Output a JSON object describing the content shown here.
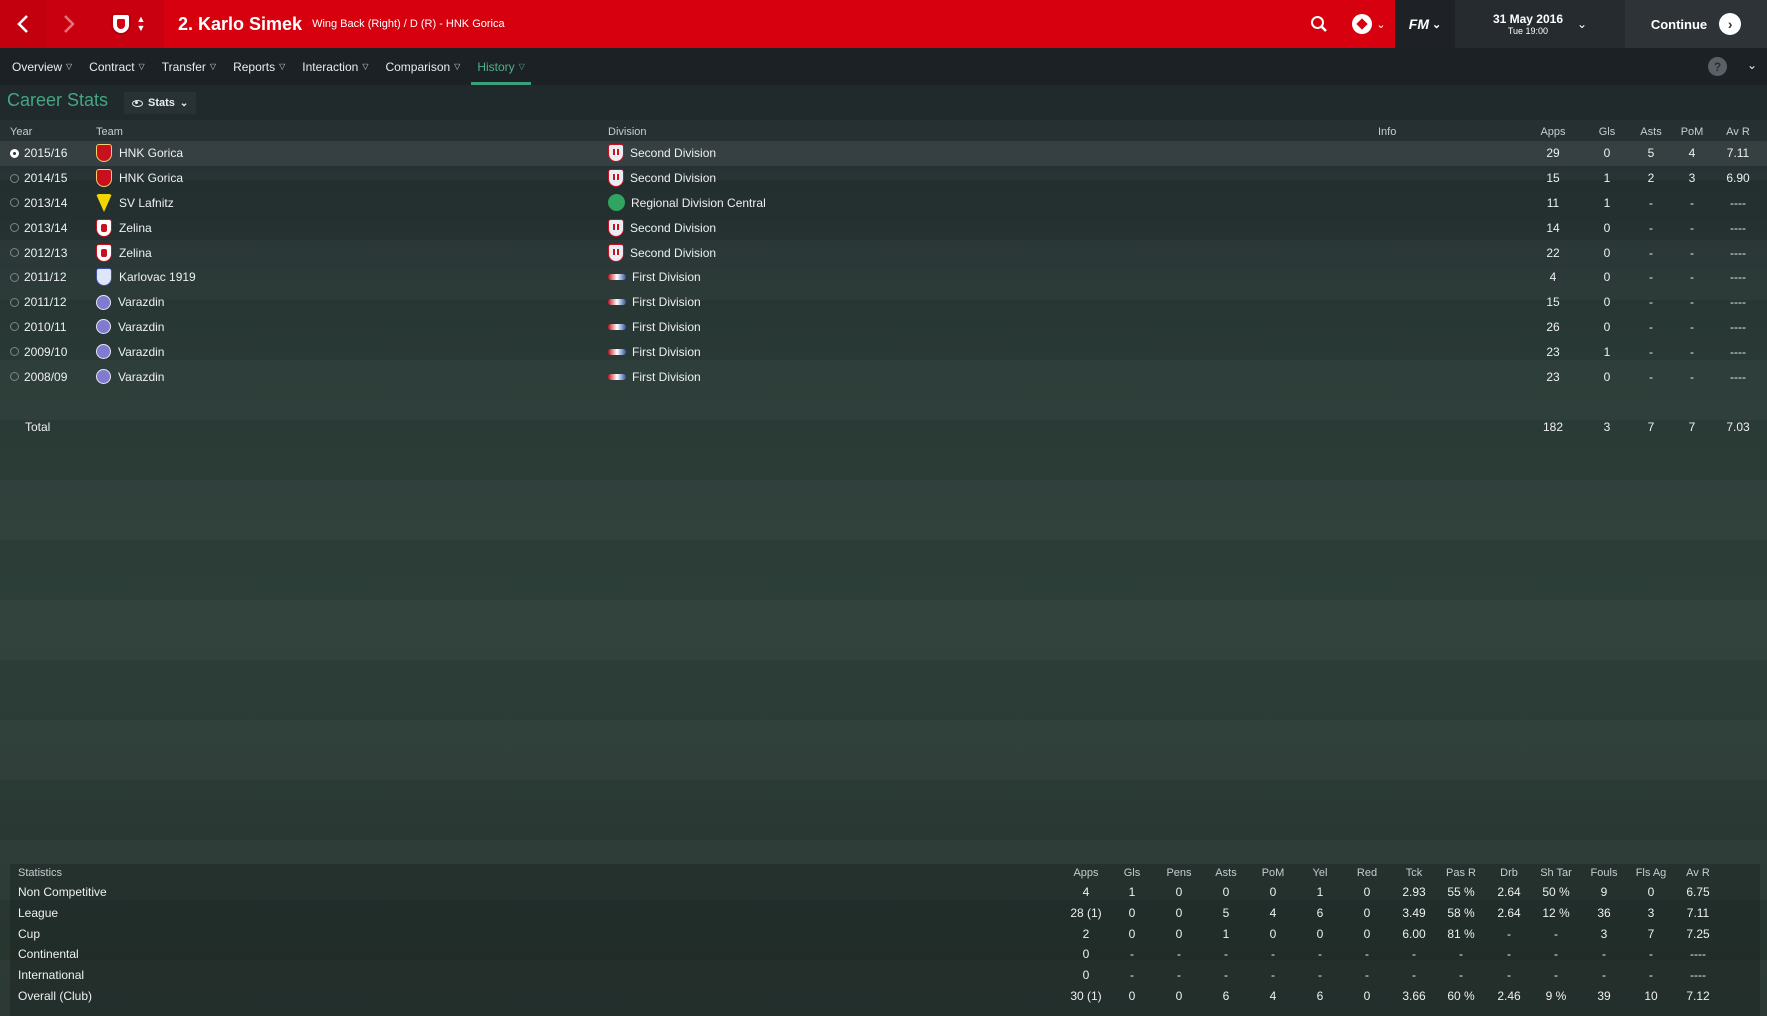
{
  "header": {
    "player_name": "2. Karlo Simek",
    "player_subtitle": "Wing Back (Right) / D (R) - HNK Gorica",
    "date": "31 May 2016",
    "day_time": "Tue 19:00",
    "continue_label": "Continue",
    "fm_label": "FM",
    "colors": {
      "bar": "#d7000f",
      "accent": "#45a683"
    }
  },
  "tabs": [
    {
      "label": "Overview"
    },
    {
      "label": "Contract"
    },
    {
      "label": "Transfer"
    },
    {
      "label": "Reports"
    },
    {
      "label": "Interaction"
    },
    {
      "label": "Comparison"
    },
    {
      "label": "History",
      "active": true
    }
  ],
  "section": {
    "title": "Career Stats",
    "view_dropdown": "Stats"
  },
  "career": {
    "columns": {
      "year": "Year",
      "team": "Team",
      "division": "Division",
      "info": "Info",
      "apps": "Apps",
      "gls": "Gls",
      "asts": "Asts",
      "pom": "PoM",
      "avr": "Av R"
    },
    "rows": [
      {
        "year": "2015/16",
        "team": "HNK Gorica",
        "team_icon": "hnk-gorica-crest-icon",
        "division": "Second Division",
        "div_icon": "croatia-league-icon",
        "apps": "29",
        "gls": "0",
        "asts": "5",
        "pom": "4",
        "avr": "7.11"
      },
      {
        "year": "2014/15",
        "team": "HNK Gorica",
        "team_icon": "hnk-gorica-crest-icon",
        "division": "Second Division",
        "div_icon": "croatia-league-icon",
        "apps": "15",
        "gls": "1",
        "asts": "2",
        "pom": "3",
        "avr": "6.90"
      },
      {
        "year": "2013/14",
        "team": "SV Lafnitz",
        "team_icon": "sv-lafnitz-crest-icon",
        "division": "Regional Division Central",
        "div_icon": "austria-league-icon",
        "apps": "11",
        "gls": "1",
        "asts": "-",
        "pom": "-",
        "avr": "----"
      },
      {
        "year": "2013/14",
        "team": "Zelina",
        "team_icon": "zelina-crest-icon",
        "division": "Second Division",
        "div_icon": "croatia-league-icon",
        "apps": "14",
        "gls": "0",
        "asts": "-",
        "pom": "-",
        "avr": "----"
      },
      {
        "year": "2012/13",
        "team": "Zelina",
        "team_icon": "zelina-crest-icon",
        "division": "Second Division",
        "div_icon": "croatia-league-icon",
        "apps": "22",
        "gls": "0",
        "asts": "-",
        "pom": "-",
        "avr": "----"
      },
      {
        "year": "2011/12",
        "team": "Karlovac 1919",
        "team_icon": "karlovac-crest-icon",
        "division": "First Division",
        "div_icon": "first-division-icon",
        "apps": "4",
        "gls": "0",
        "asts": "-",
        "pom": "-",
        "avr": "----"
      },
      {
        "year": "2011/12",
        "team": "Varazdin",
        "team_icon": "varazdin-crest-icon",
        "division": "First Division",
        "div_icon": "first-division-icon",
        "apps": "15",
        "gls": "0",
        "asts": "-",
        "pom": "-",
        "avr": "----"
      },
      {
        "year": "2010/11",
        "team": "Varazdin",
        "team_icon": "varazdin-crest-icon",
        "division": "First Division",
        "div_icon": "first-division-icon",
        "apps": "26",
        "gls": "0",
        "asts": "-",
        "pom": "-",
        "avr": "----"
      },
      {
        "year": "2009/10",
        "team": "Varazdin",
        "team_icon": "varazdin-crest-icon",
        "division": "First Division",
        "div_icon": "first-division-icon",
        "apps": "23",
        "gls": "1",
        "asts": "-",
        "pom": "-",
        "avr": "----"
      },
      {
        "year": "2008/09",
        "team": "Varazdin",
        "team_icon": "varazdin-crest-icon",
        "division": "First Division",
        "div_icon": "first-division-icon",
        "apps": "23",
        "gls": "0",
        "asts": "-",
        "pom": "-",
        "avr": "----"
      }
    ],
    "total": {
      "label": "Total",
      "apps": "182",
      "gls": "3",
      "asts": "7",
      "pom": "7",
      "avr": "7.03"
    }
  },
  "statistics": {
    "columns": [
      "Statistics",
      "Apps",
      "Gls",
      "Pens",
      "Asts",
      "PoM",
      "Yel",
      "Red",
      "Tck",
      "Pas R",
      "Drb",
      "Sh Tar",
      "Fouls",
      "Fls Ag",
      "Av R"
    ],
    "rows": [
      [
        "Non Competitive",
        "4",
        "1",
        "0",
        "0",
        "0",
        "1",
        "0",
        "2.93",
        "55 %",
        "2.64",
        "50 %",
        "9",
        "0",
        "6.75"
      ],
      [
        "League",
        "28 (1)",
        "0",
        "0",
        "5",
        "4",
        "6",
        "0",
        "3.49",
        "58 %",
        "2.64",
        "12 %",
        "36",
        "3",
        "7.11"
      ],
      [
        "Cup",
        "2",
        "0",
        "0",
        "1",
        "0",
        "0",
        "0",
        "6.00",
        "81 %",
        "-",
        "-",
        "3",
        "7",
        "7.25"
      ],
      [
        "Continental",
        "0",
        "-",
        "-",
        "-",
        "-",
        "-",
        "-",
        "-",
        "-",
        "-",
        "-",
        "-",
        "-",
        "----"
      ],
      [
        "International",
        "0",
        "-",
        "-",
        "-",
        "-",
        "-",
        "-",
        "-",
        "-",
        "-",
        "-",
        "-",
        "-",
        "----"
      ],
      [
        "Overall (Club)",
        "30 (1)",
        "0",
        "0",
        "6",
        "4",
        "6",
        "0",
        "3.66",
        "60 %",
        "2.46",
        "9 %",
        "39",
        "10",
        "7.12"
      ]
    ]
  }
}
